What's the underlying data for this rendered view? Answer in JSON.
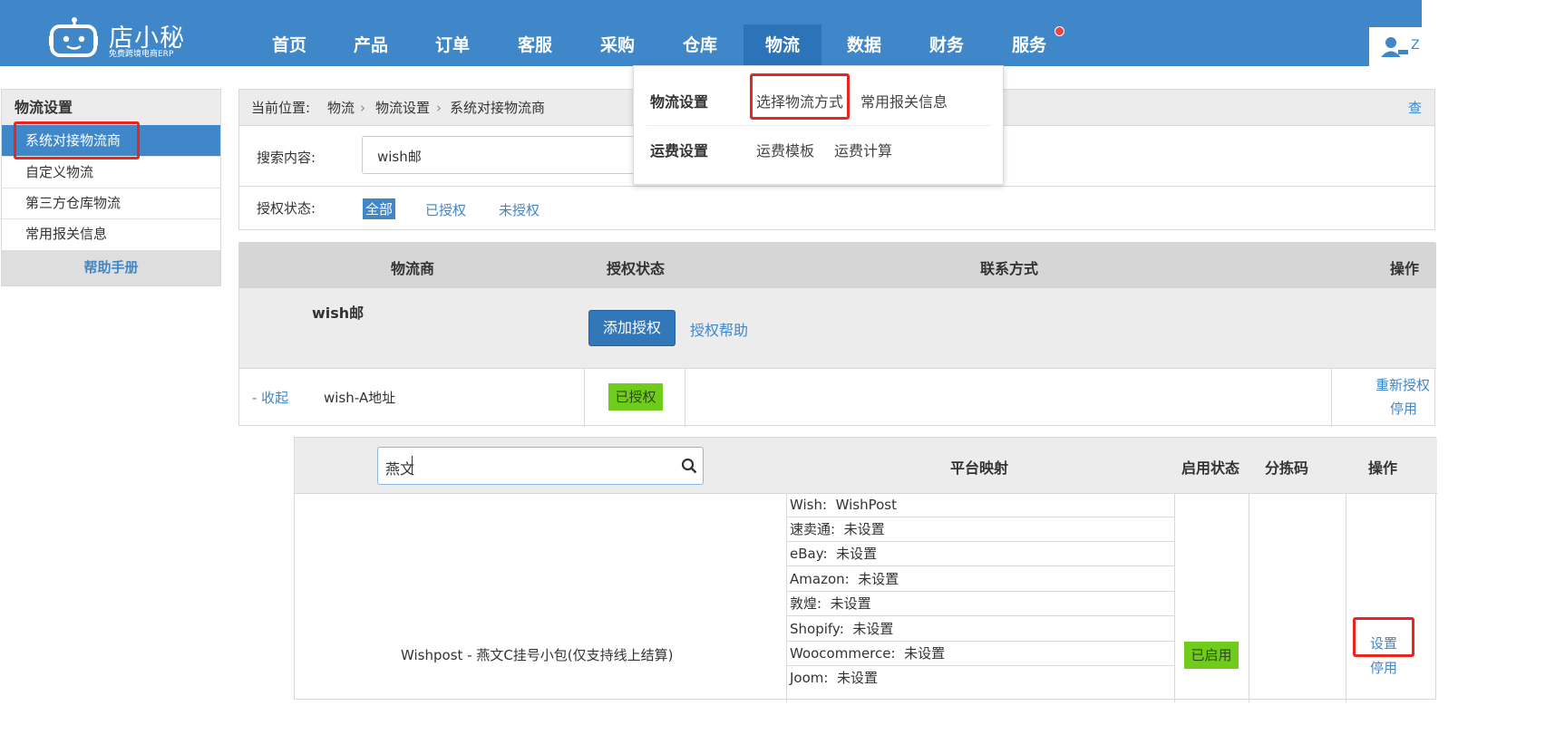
{
  "header": {
    "brand": "店小秘",
    "brand_sub": "免费跨境电商ERP",
    "nav": [
      "首页",
      "产品",
      "订单",
      "客服",
      "采购",
      "仓库",
      "物流",
      "数据",
      "财务",
      "服务"
    ],
    "active_nav": "物流",
    "user_initial": "Z"
  },
  "dropdown": {
    "row1_label": "物流设置",
    "row1_links": [
      "选择物流方式",
      "常用报关信息"
    ],
    "row2_label": "运费设置",
    "row2_links": [
      "运费模板",
      "运费计算"
    ]
  },
  "sidebar": {
    "title": "物流设置",
    "items": [
      "系统对接物流商",
      "自定义物流",
      "第三方仓库物流",
      "常用报关信息"
    ],
    "help": "帮助手册"
  },
  "breadcrumb": {
    "prefix": "当前位置:",
    "items": [
      "物流",
      "物流设置",
      "系统对接物流商"
    ],
    "right_link": "查"
  },
  "search": {
    "label": "搜索内容:",
    "value": "wish邮"
  },
  "auth_filter": {
    "label": "授权状态:",
    "options": [
      "全部",
      "已授权",
      "未授权"
    ]
  },
  "table": {
    "headers": [
      "物流商",
      "授权状态",
      "联系方式",
      "操作"
    ],
    "carrier_name": "wish邮",
    "add_auth_button": "添加授权",
    "auth_help_link": "授权帮助",
    "account_row": {
      "collapse": "- 收起",
      "name": "wish-A地址",
      "status": "已授权",
      "actions": [
        "重新授权",
        "停用"
      ]
    }
  },
  "shipping_table": {
    "search_value": "燕文",
    "headers": [
      "平台映射",
      "启用状态",
      "分拣码",
      "操作"
    ],
    "service_name": "Wishpost - 燕文C挂号小包(仅支持线上结算)",
    "mappings": [
      {
        "platform": "Wish:",
        "value": "WishPost"
      },
      {
        "platform": "速卖通:",
        "value": "未设置"
      },
      {
        "platform": "eBay:",
        "value": "未设置"
      },
      {
        "platform": "Amazon:",
        "value": "未设置"
      },
      {
        "platform": "敦煌:",
        "value": "未设置"
      },
      {
        "platform": "Shopify:",
        "value": "未设置"
      },
      {
        "platform": "Woocommerce:",
        "value": "未设置"
      },
      {
        "platform": "Joom:",
        "value": "未设置"
      }
    ],
    "status": "已启用",
    "actions": [
      "设置",
      "停用"
    ]
  },
  "colors": {
    "primary": "#3f87c9",
    "nav_active": "#2c73b8",
    "highlight_red": "#e8261f",
    "badge_green": "#6fcc1a"
  }
}
